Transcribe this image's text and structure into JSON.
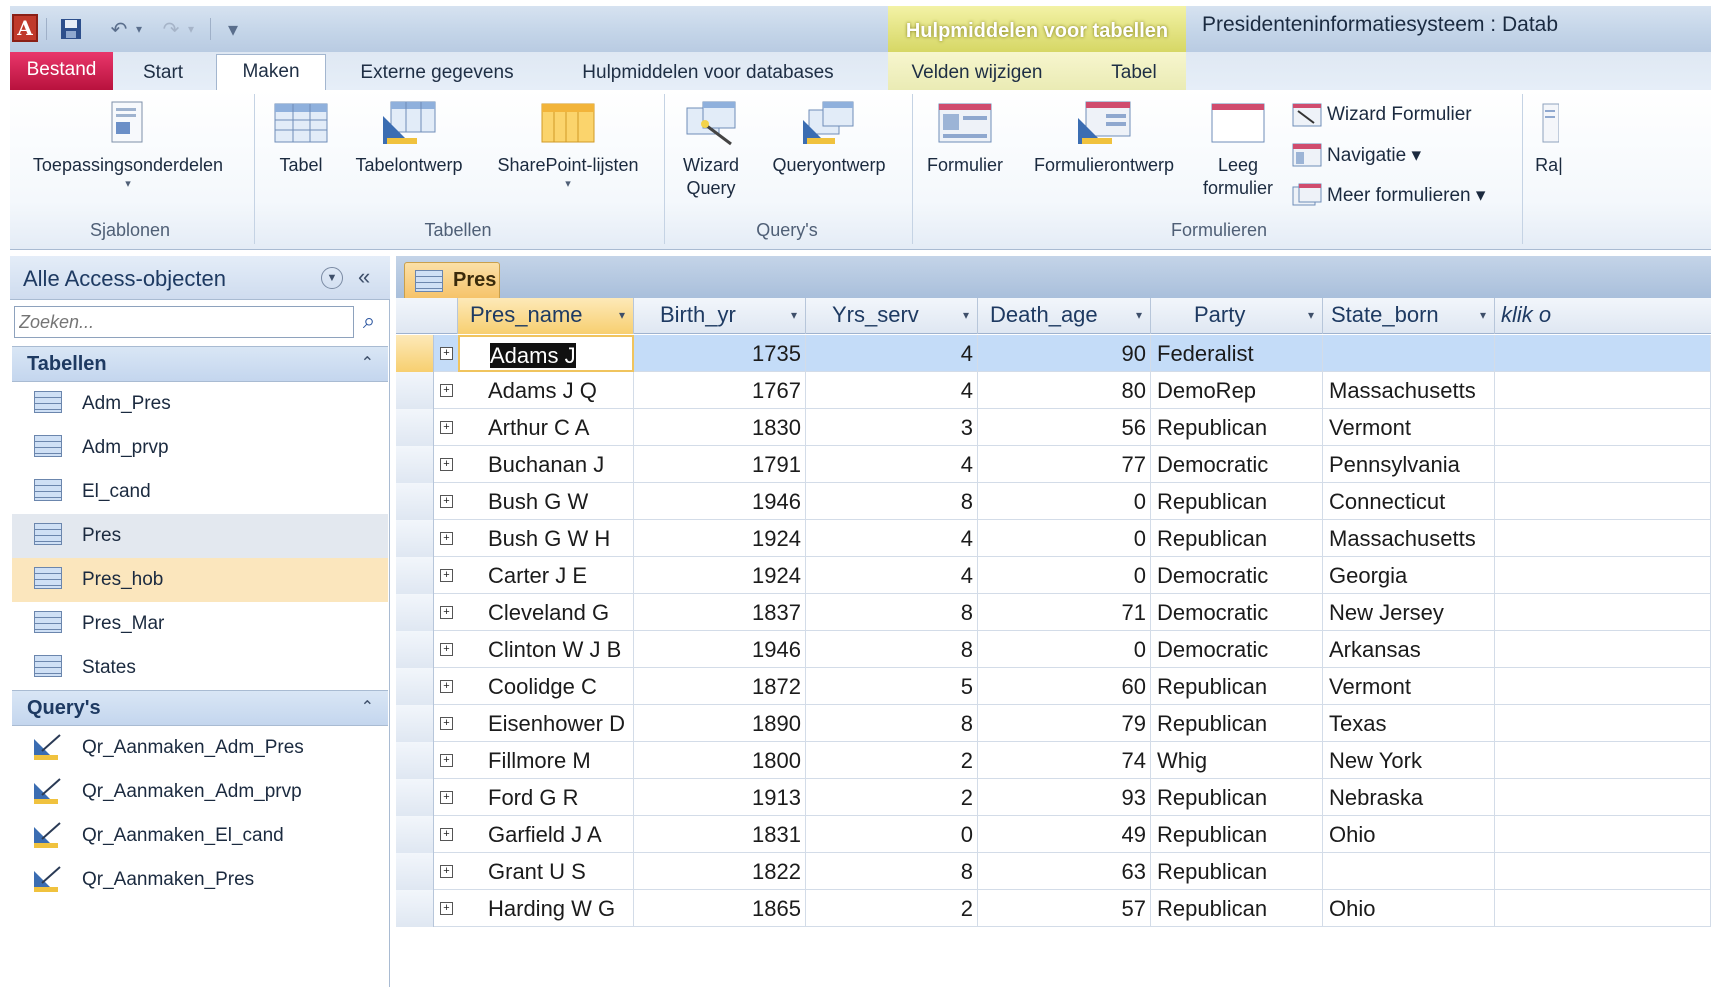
{
  "titlebar": {
    "app_icon_letter": "A",
    "context_group": "Hulpmiddelen voor tabellen",
    "app_title": "Presidenteninformatiesysteem : Datab",
    "qa_custom": "▾"
  },
  "tabs": {
    "file": "Bestand",
    "start": "Start",
    "create": "Maken",
    "external": "Externe gegevens",
    "dbtools": "Hulpmiddelen voor databases",
    "fields": "Velden wijzigen",
    "table": "Tabel"
  },
  "ribbon": {
    "templates": {
      "label": "Sjablonen",
      "app_parts": "Toepassingsonderdelen"
    },
    "tables": {
      "label": "Tabellen",
      "table": "Tabel",
      "table_design": "Tabelontwerp",
      "sharepoint": "SharePoint-lijsten"
    },
    "queries": {
      "label": "Query's",
      "wizard1": "Wizard",
      "wizard2": "Query",
      "design": "Queryontwerp"
    },
    "forms": {
      "label": "Formulieren",
      "form": "Formulier",
      "form_design": "Formulierontwerp",
      "blank1": "Leeg",
      "blank2": "formulier",
      "wizard": "Wizard Formulier",
      "navigation": "Navigatie ▾",
      "more": "Meer formulieren ▾"
    },
    "reports": {
      "partial": "Ra|"
    }
  },
  "nav": {
    "title": "Alle Access-objecten",
    "search_placeholder": "Zoeken...",
    "tables_header": "Tabellen",
    "tables": [
      "Adm_Pres",
      "Adm_prvp",
      "El_cand",
      "Pres",
      "Pres_hob",
      "Pres_Mar",
      "States"
    ],
    "queries_header": "Query's",
    "queries": [
      "Qr_Aanmaken_Adm_Pres",
      "Qr_Aanmaken_Adm_prvp",
      "Qr_Aanmaken_El_cand",
      "Qr_Aanmaken_Pres"
    ]
  },
  "document": {
    "tab": "Pres",
    "columns": [
      "Pres_name",
      "Birth_yr",
      "Yrs_serv",
      "Death_age",
      "Party",
      "State_born",
      "klik o"
    ],
    "rows": [
      [
        "Adams J",
        "1735",
        "4",
        "90",
        "Federalist",
        ""
      ],
      [
        "Adams J Q",
        "1767",
        "4",
        "80",
        "DemoRep",
        "Massachusetts"
      ],
      [
        "Arthur C A",
        "1830",
        "3",
        "56",
        "Republican",
        "Vermont"
      ],
      [
        "Buchanan J",
        "1791",
        "4",
        "77",
        "Democratic",
        "Pennsylvania"
      ],
      [
        "Bush G W",
        "1946",
        "8",
        "0",
        "Republican",
        "Connecticut"
      ],
      [
        "Bush G W H",
        "1924",
        "4",
        "0",
        "Republican",
        "Massachusetts"
      ],
      [
        "Carter J E",
        "1924",
        "4",
        "0",
        "Democratic",
        "Georgia"
      ],
      [
        "Cleveland G",
        "1837",
        "8",
        "71",
        "Democratic",
        "New Jersey"
      ],
      [
        "Clinton W J B",
        "1946",
        "8",
        "0",
        "Democratic",
        "Arkansas"
      ],
      [
        "Coolidge C",
        "1872",
        "5",
        "60",
        "Republican",
        "Vermont"
      ],
      [
        "Eisenhower D",
        "1890",
        "8",
        "79",
        "Republican",
        "Texas"
      ],
      [
        "Fillmore M",
        "1800",
        "2",
        "74",
        "Whig",
        "New York"
      ],
      [
        "Ford G R",
        "1913",
        "2",
        "93",
        "Republican",
        "Nebraska"
      ],
      [
        "Garfield J A",
        "1831",
        "0",
        "49",
        "Republican",
        "Ohio"
      ],
      [
        "Grant U S",
        "1822",
        "8",
        "63",
        "Republican",
        ""
      ],
      [
        "Harding W G",
        "1865",
        "2",
        "57",
        "Republican",
        "Ohio"
      ]
    ]
  },
  "colors": {
    "file_tab": "#c8164a",
    "context_tab": "#d8d86a",
    "selected_row": "#c4dcf8",
    "active_header": "#f7cf70"
  }
}
